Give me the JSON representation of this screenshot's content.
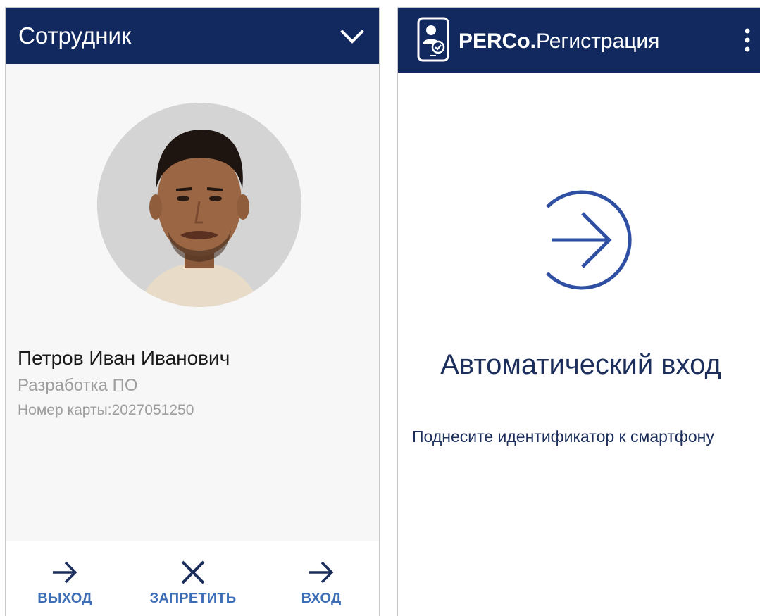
{
  "left_screen": {
    "title": "Сотрудник",
    "employee": {
      "name": "Петров Иван Иванович",
      "department": "Разработка ПО",
      "card_number_label": "Номер карты:",
      "card_number": "2027051250"
    },
    "actions": [
      {
        "label": "ВЫХОД",
        "icon": "arrow-right-icon"
      },
      {
        "label": "ЗАПРЕТИТЬ",
        "icon": "close-icon"
      },
      {
        "label": "ВХОД",
        "icon": "arrow-right-icon"
      }
    ]
  },
  "right_screen": {
    "brand_bold": "PERCo.",
    "brand_rest": "Регистрация",
    "status_title": "Автоматический вход",
    "hint": "Поднесите идентификатор к смартфону"
  },
  "colors": {
    "appbar": "#12295f",
    "action_label": "#3d6eb5",
    "icon_dark": "#1b2e5c",
    "icon_light": "#2f4fa3",
    "muted_text": "#9e9e9e"
  }
}
